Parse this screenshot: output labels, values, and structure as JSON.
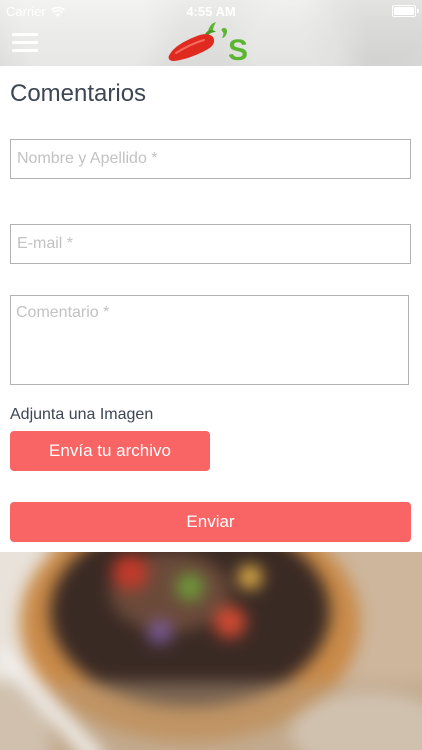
{
  "status_bar": {
    "carrier": "Carrier",
    "time": "4:55 AM",
    "battery_level": 1.0
  },
  "header": {
    "menu_icon": "hamburger-menu-icon",
    "logo_text": "’S",
    "logo_icon": "chili-pepper-logo-icon"
  },
  "form": {
    "title": "Comentarios",
    "name_placeholder": "Nombre y Apellido *",
    "email_placeholder": "E-mail *",
    "comment_placeholder": "Comentario *",
    "attach_label": "Adjunta una Imagen",
    "file_button_label": "Envía tu archivo",
    "submit_label": "Enviar"
  },
  "colors": {
    "accent": "#f96464",
    "title_text": "#3d4653",
    "logo_red": "#e0291f",
    "logo_green": "#5cb531"
  }
}
